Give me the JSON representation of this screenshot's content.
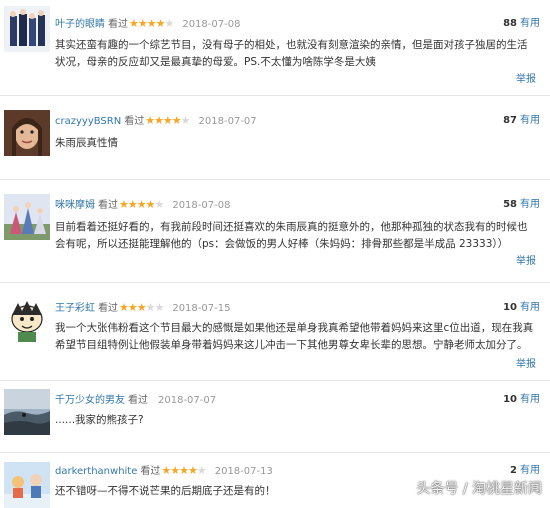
{
  "labels": {
    "watched": "看过",
    "useful": "有用",
    "report": "举报"
  },
  "colors": {
    "link": "#3377aa",
    "star": "#f5a623",
    "star_off": "#d9d9d9"
  },
  "reviews": [
    {
      "user": "叶子的眼睛",
      "rating": 4,
      "stars_text": "★★★★",
      "stars_off_text": "★",
      "date": "2018-07-08",
      "useful_count": "88",
      "text": "其实还蛮有趣的一个综艺节目，没有母子的相处，也就没有刻意渲染的亲情，但是面对孩子独居的生活状况，母亲的反应却又是最真挚的母爱。PS.不太懂为啥陈学冬是大姨"
    },
    {
      "user": "crazyyyBSRN",
      "rating": 4,
      "stars_text": "★★★★",
      "stars_off_text": "★",
      "date": "2018-07-07",
      "useful_count": "87",
      "text": "朱雨辰真性情"
    },
    {
      "user": "咪咪摩姆",
      "rating": 4,
      "stars_text": "★★★★",
      "stars_off_text": "★",
      "date": "2018-07-08",
      "useful_count": "58",
      "text": "目前看着还挺好看的，有我前段时间还挺喜欢的朱雨辰真的挺意外的，他那种孤独的状态我有的时候也会有呢，所以还挺能理解他的（ps：会做饭的男人好棒（朱妈妈：排骨那些都是半成品 23333））"
    },
    {
      "user": "王子彩虹",
      "rating": 3,
      "stars_text": "★★★",
      "stars_off_text": "★★",
      "date": "2018-07-15",
      "useful_count": "10",
      "text": "我一个大张伟粉看这个节目最大的感慨是如果他还是单身我真希望他带着妈妈来这里c位出道，现在我真希望节目组特例让他假装单身带着妈妈来这儿冲击一下其他男尊女卑长辈的思想。宁静老师太加分了。"
    },
    {
      "user": "千万少女的男友",
      "rating": 0,
      "stars_text": "",
      "stars_off_text": "",
      "date": "2018-07-07",
      "useful_count": "10",
      "text": "......我家的熊孩子?"
    },
    {
      "user": "darkerthanwhite",
      "rating": 4,
      "stars_text": "★★★★",
      "stars_off_text": "★",
      "date": "2018-07-13",
      "useful_count": "2",
      "text": "还不错呀—不得不说芒果的后期底子还是有的！"
    }
  ],
  "watermark": "头条号 / 淘桃星新闻"
}
